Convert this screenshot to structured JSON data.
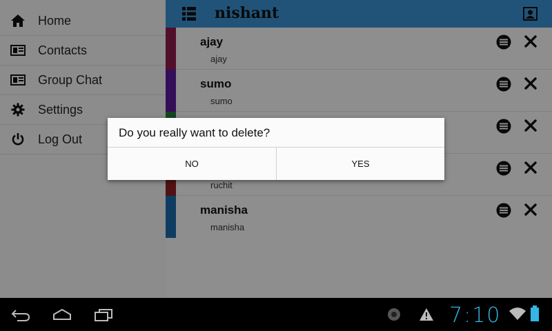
{
  "drawer": {
    "items": [
      {
        "label": "Home",
        "icon": "home-icon"
      },
      {
        "label": "Contacts",
        "icon": "contact-card-icon"
      },
      {
        "label": "Group Chat",
        "icon": "contact-card-icon"
      },
      {
        "label": "Settings",
        "icon": "gear-icon"
      },
      {
        "label": "Log Out",
        "icon": "power-icon"
      }
    ]
  },
  "header": {
    "title": "nishant",
    "color": "#3a8fd0"
  },
  "contacts": [
    {
      "name": "ajay",
      "sub": "ajay",
      "color": "#8b1a4a"
    },
    {
      "name": "sumo",
      "sub": "sumo",
      "color": "#5a1a9a"
    },
    {
      "name": "",
      "sub": "",
      "color": "#1f7a3a"
    },
    {
      "name": "",
      "sub": "ruchit",
      "color": "#8a2020"
    },
    {
      "name": "manisha",
      "sub": "manisha",
      "color": "#1a6aa8"
    }
  ],
  "dialog": {
    "message": "Do you really want to delete?",
    "no_label": "NO",
    "yes_label": "YES"
  },
  "system": {
    "time": "7:10",
    "accent": "#33b5e5"
  }
}
